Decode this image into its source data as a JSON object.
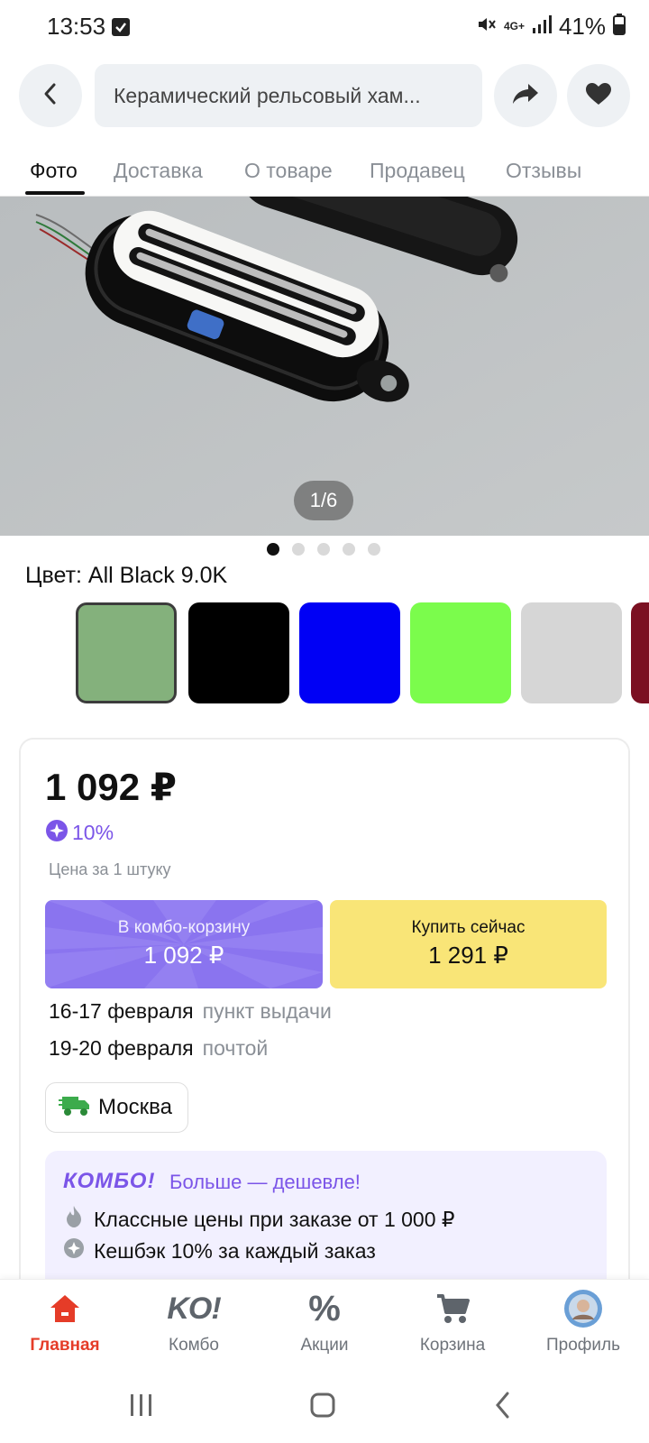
{
  "status_bar": {
    "time": "13:53",
    "battery": "41%",
    "network": "4G+",
    "icons": [
      "checkbox-notification-icon",
      "mute-icon",
      "signal-icon",
      "battery-icon"
    ]
  },
  "header": {
    "search_text": "Керамический рельсовый хам...",
    "icons": [
      "back-arrow-icon",
      "share-icon",
      "heart-icon"
    ]
  },
  "tabs": [
    {
      "label": "Фото",
      "active": true
    },
    {
      "label": "Доставка",
      "active": false
    },
    {
      "label": "О товаре",
      "active": false
    },
    {
      "label": "Продавец",
      "active": false
    },
    {
      "label": "Отзывы",
      "active": false
    }
  ],
  "gallery": {
    "counter": "1/6",
    "dots": 5,
    "active_dot": 0
  },
  "color_picker": {
    "label": "Цвет: All Black 9.0K",
    "swatches": [
      {
        "color": "#84b17c",
        "selected": true
      },
      {
        "color": "#000000",
        "selected": false
      },
      {
        "color": "#0000f5",
        "selected": false
      },
      {
        "color": "#7bfc4c",
        "selected": false
      },
      {
        "color": "#d6d6d6",
        "selected": false
      },
      {
        "color": "#7b1022",
        "selected": false
      }
    ]
  },
  "product": {
    "price": "1 092 ₽",
    "cashback": "10%",
    "per_unit": "Цена за 1 штуку",
    "combo_button": {
      "label": "В комбо-корзину",
      "amount": "1 092 ₽"
    },
    "buy_button": {
      "label": "Купить сейчас",
      "amount": "1 291 ₽"
    },
    "delivery": [
      {
        "date": "16-17 февраля",
        "method": "пункт выдачи"
      },
      {
        "date": "19-20 февраля",
        "method": "почтой"
      }
    ],
    "city": "Москва"
  },
  "combo_promo": {
    "logo": "КОМБО!",
    "slogan": "Больше — дешевле!",
    "items": [
      {
        "icon": "fire-icon",
        "text": "Классные цены при заказе от 1 000 ₽"
      },
      {
        "icon": "star-badge-icon",
        "text": "Кешбэк 10% за каждый заказ"
      }
    ]
  },
  "bottom_nav": [
    {
      "label": "Главная",
      "active": true,
      "icon": "home-icon"
    },
    {
      "label": "Комбо",
      "active": false,
      "icon": "ko-icon",
      "icon_text": "KO!"
    },
    {
      "label": "Акции",
      "active": false,
      "icon": "percent-icon",
      "icon_text": "%"
    },
    {
      "label": "Корзина",
      "active": false,
      "icon": "cart-icon"
    },
    {
      "label": "Профиль",
      "active": false,
      "icon": "avatar"
    }
  ],
  "colors": {
    "accent_purple": "#7b55e8",
    "buy_yellow": "#f9e577",
    "active_red": "#e53c28"
  }
}
